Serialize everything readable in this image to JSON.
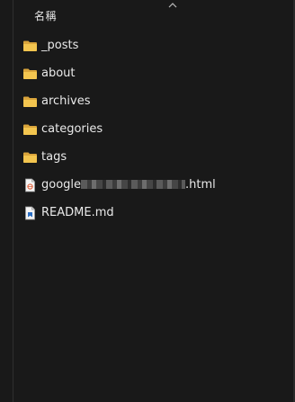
{
  "header": {
    "name_column_label": "名稱"
  },
  "files": [
    {
      "name": "_posts",
      "type": "folder"
    },
    {
      "name": "about",
      "type": "folder"
    },
    {
      "name": "archives",
      "type": "folder"
    },
    {
      "name": "categories",
      "type": "folder"
    },
    {
      "name": "tags",
      "type": "folder"
    },
    {
      "name_prefix": "google",
      "name_suffix": ".html",
      "type": "html-file",
      "redacted": true
    },
    {
      "name": "README.md",
      "type": "markdown-file"
    }
  ],
  "colors": {
    "background": "#191919",
    "text": "#e9e9e9",
    "folder": "#f3c54f",
    "folder_dark": "#d9a43b"
  }
}
